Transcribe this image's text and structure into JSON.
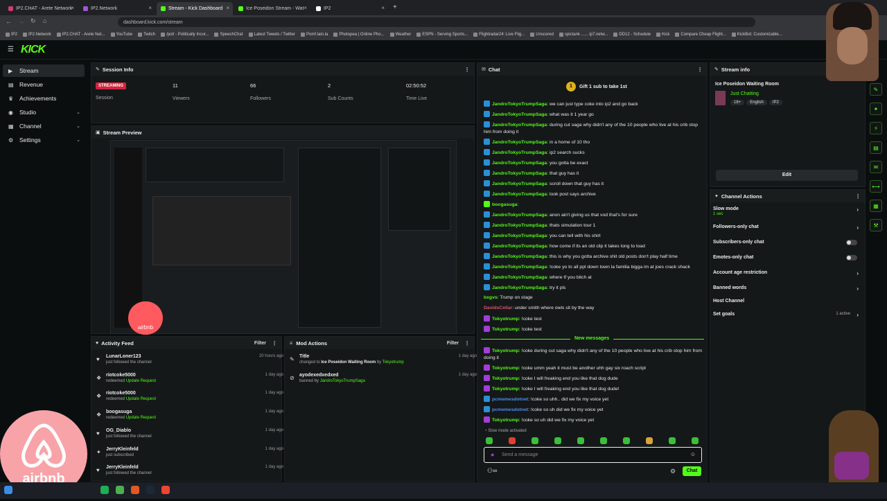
{
  "browser": {
    "tabs": [
      {
        "label": "IP2.CHAT - Arete Network",
        "color": "#d33a7a"
      },
      {
        "label": "IP2.Network",
        "color": "#a155d8"
      },
      {
        "label": "Stream - Kick Dashboard",
        "color": "#53fc18"
      },
      {
        "label": "Ice Poseidon Stream - Wat",
        "color": "#53fc18"
      },
      {
        "label": "IP2",
        "color": "#ffffff"
      }
    ],
    "url": "dashboard.kick.com/stream",
    "bookmarks": [
      "IP2",
      "IP2.Network",
      "IP2.CHAT - Arete Net...",
      "YouTube",
      "Twitch",
      "/pol/ - Politically Incor...",
      "SpeechChat",
      "Latest Tweets / Twitter",
      "Pomf.lain.la",
      "Photopea | Online Pho...",
      "Weather",
      "ESPN - Serving Sports...",
      "Flightradar24: Live Flig...",
      "Unscored",
      "spictank ...... ip7.netw...",
      "DD12 - Schedule",
      "Kick",
      "Compare Cheap Flight...",
      "KickBot: Customizable..."
    ]
  },
  "app": {
    "logo": "KICK"
  },
  "sidebar": {
    "items": [
      {
        "label": "Stream",
        "icon": "stream-icon"
      },
      {
        "label": "Revenue",
        "icon": "revenue-icon"
      },
      {
        "label": "Achievements",
        "icon": "trophy-icon"
      },
      {
        "label": "Studio",
        "icon": "studio-icon"
      },
      {
        "label": "Channel",
        "icon": "channel-icon"
      },
      {
        "label": "Settings",
        "icon": "gear-icon"
      }
    ]
  },
  "session": {
    "title": "Session Info",
    "status": "STREAMING",
    "status_label": "Session",
    "viewers": "11",
    "viewers_label": "Viewers",
    "followers": "66",
    "followers_label": "Followers",
    "subs": "2",
    "subs_label": "Sub Counts",
    "time": "02:50:52",
    "time_label": "Time Live"
  },
  "preview": {
    "title": "Stream Preview"
  },
  "activity": {
    "title": "Activity Feed",
    "filter": "Filter",
    "items": [
      {
        "name": "LunarLoner123",
        "action": "just followed the channel",
        "highlight": "",
        "time": "20 hours ago",
        "icon": "heart-icon"
      },
      {
        "name": "riotcoke5000",
        "action": "redeemed",
        "highlight": "Update Request",
        "time": "1 day ago",
        "icon": "redeem-icon"
      },
      {
        "name": "riotcoke5000",
        "action": "redeemed",
        "highlight": "Update Request",
        "time": "1 day ago",
        "icon": "redeem-icon"
      },
      {
        "name": "boogasuga",
        "action": "redeemed",
        "highlight": "Update Request",
        "time": "1 day ago",
        "icon": "redeem-icon"
      },
      {
        "name": "OG_Diablo",
        "action": "just followed the channel",
        "highlight": "",
        "time": "1 day ago",
        "icon": "heart-icon"
      },
      {
        "name": "JerryKleinfeld",
        "action": "just subscribed",
        "highlight": "",
        "time": "1 day ago",
        "icon": "star-icon"
      },
      {
        "name": "JerryKleinfeld",
        "action": "just followed the channel",
        "highlight": "",
        "time": "1 day ago",
        "icon": "heart-icon"
      }
    ]
  },
  "mod": {
    "title": "Mod Actions",
    "filter": "Filter",
    "items": [
      {
        "name": "Title",
        "line": "changed to",
        "target": "Ice Poseidon Waiting Room",
        "by": "by",
        "actor": "Tokyotrump",
        "time": "1 day ago"
      },
      {
        "name": "ayodexedxedxed",
        "line": "banned by",
        "target": "",
        "by": "",
        "actor": "JandroTokyoTrumpSaga",
        "time": "1 day ago"
      }
    ]
  },
  "chat": {
    "title": "Chat",
    "gift": "Gift 1 sub to take 1st",
    "messages": [
      {
        "user": "JandroTokyoTrumpSaga",
        "text": "we can just type coke into ip2 and go back",
        "badge": "b"
      },
      {
        "user": "JandroTokyoTrumpSaga",
        "text": "what was it 1 year go",
        "badge": "b"
      },
      {
        "user": "JandroTokyoTrumpSaga",
        "text": "during cut saga why didn't any of the 10 people who live at his crib stop him from doing it",
        "badge": "b"
      },
      {
        "user": "JandroTokyoTrumpSaga",
        "text": "in a home of 10 tho",
        "badge": "b"
      },
      {
        "user": "JandroTokyoTrumpSaga",
        "text": "ip2 search sucks",
        "badge": "b"
      },
      {
        "user": "JandroTokyoTrumpSaga",
        "text": "you gotta be exact",
        "badge": "b"
      },
      {
        "user": "JandroTokyoTrumpSaga",
        "text": "that guy has it",
        "badge": "b"
      },
      {
        "user": "JandroTokyoTrumpSaga",
        "text": "scroll down that guy has it",
        "badge": "b"
      },
      {
        "user": "JandroTokyoTrumpSaga",
        "text": "look post says archive",
        "badge": "b"
      },
      {
        "user": "boogasuga",
        "text": "",
        "badge": "g"
      },
      {
        "user": "JandroTokyoTrumpSaga",
        "text": "anon ain't giving us that vod that's for sure",
        "badge": "b"
      },
      {
        "user": "JandroTokyoTrumpSaga",
        "text": "thats simulation tour 1",
        "badge": "b"
      },
      {
        "user": "JandroTokyoTrumpSaga",
        "text": "you can tell with his shirt",
        "badge": "b"
      },
      {
        "user": "JandroTokyoTrumpSaga",
        "text": "how come if its an old clip it takes long to load",
        "badge": "b"
      },
      {
        "user": "JandroTokyoTrumpSaga",
        "text": "this is why you gotta archive shit old posts don't play half time",
        "badge": "b"
      },
      {
        "user": "JandroTokyoTrumpSaga",
        "text": "!coke yo to all ppl down town la familia bigga im at joes crack shack",
        "badge": "b"
      },
      {
        "user": "JandroTokyoTrumpSaga",
        "text": "where tf you bitch at",
        "badge": "b"
      },
      {
        "user": "JandroTokyoTrumpSaga",
        "text": "try it pls",
        "badge": "b"
      },
      {
        "user": "bxgvs",
        "text": "Trump on stage",
        "badge": ""
      },
      {
        "user": "DavidsCellar",
        "text": "under smith where owls sit by the way",
        "badge": ""
      },
      {
        "user": "Tokyotrump",
        "text": "!coke test",
        "badge": "p"
      },
      {
        "user": "Tokyotrump",
        "text": "!coke test",
        "badge": "p"
      }
    ],
    "new_label": "New messages",
    "new_messages": [
      {
        "user": "Tokyotrump",
        "text": "!coke during cut saga why didn't any of the 10 people who live at his crib stop him from doing it",
        "badge": "p"
      },
      {
        "user": "Tokyotrump",
        "text": "!coke umm yeah it must be another uhh gay six roach script",
        "badge": "p"
      },
      {
        "user": "Tokyotrump",
        "text": "!coke I will freaking end you like that dog dude",
        "badge": "p"
      },
      {
        "user": "Tokyotrump",
        "text": "!coke I will freaking end you like that dog dude!",
        "badge": "p"
      },
      {
        "user": "pcmemesdotnet",
        "text": "!coke so uhh.. did we fix my voice yet",
        "badge": "b"
      },
      {
        "user": "pcmemesdotnet",
        "text": "!coke so uh did we fix my voice yet",
        "badge": "b"
      },
      {
        "user": "Tokyotrump",
        "text": "!coke so uh did we fix my voice yet",
        "badge": "p"
      }
    ],
    "slow_mode": "Slow mode activated",
    "placeholder": "Send a message",
    "send": "Chat",
    "infinity": "∞"
  },
  "stream_info": {
    "title": "Stream info",
    "stream_title": "Ice Poseidon Waiting Room",
    "category": "Just Chatting",
    "tags": [
      "18+",
      "English",
      "IP2"
    ],
    "edit": "Edit"
  },
  "channel_actions": {
    "title": "Channel Actions",
    "items": [
      {
        "label": "Slow mode",
        "sub": "1 sec",
        "control": "chevron"
      },
      {
        "label": "Followers-only chat",
        "sub": "",
        "control": "chevron"
      },
      {
        "label": "Subscribers-only chat",
        "sub": "",
        "control": "toggle"
      },
      {
        "label": "Emotes-only chat",
        "sub": "",
        "control": "toggle"
      },
      {
        "label": "Account age restriction",
        "sub": "",
        "control": "chevron"
      },
      {
        "label": "Banned words",
        "sub": "",
        "control": "chevron"
      },
      {
        "label": "Host Channel",
        "sub": "",
        "control": "none"
      },
      {
        "label": "Set goals",
        "sub": "",
        "control": "chevron",
        "extra": "1 active"
      }
    ]
  },
  "overlay": {
    "airbnb": "airbnb"
  },
  "colors": {
    "accent": "#53fc18",
    "streaming": "#d3243c",
    "panel": "#151819"
  }
}
